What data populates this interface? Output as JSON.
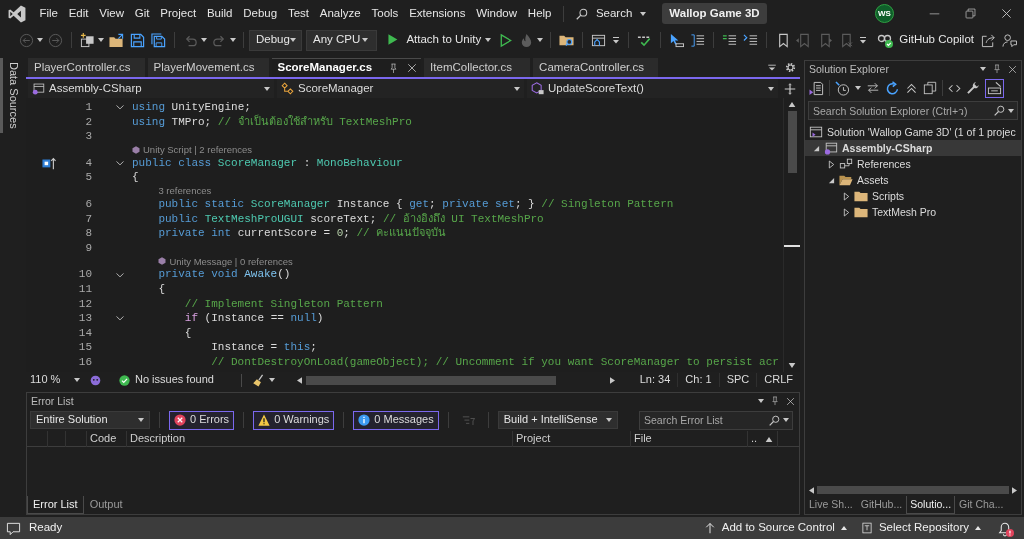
{
  "menu_bar": {
    "items": [
      "File",
      "Edit",
      "View",
      "Git",
      "Project",
      "Build",
      "Debug",
      "Test",
      "Analyze",
      "Tools",
      "Extensions",
      "Window",
      "Help"
    ],
    "search": "Search",
    "solution_name": "Wallop Game 3D",
    "user_initials": "WS"
  },
  "toolbar": {
    "back": {
      "disabled": true
    },
    "forward": {
      "disabled": true
    },
    "undo": {
      "disabled": true
    },
    "redo": {
      "disabled": true
    },
    "hot_reload": {
      "disabled": true
    },
    "previous_bookmark": {
      "disabled": true
    },
    "next_bookmark": {
      "disabled": true
    },
    "clear_bookmarks": {
      "disabled": true
    },
    "configuration": "Debug",
    "platform": "Any CPU",
    "start": "Attach to Unity",
    "copilot": "GitHub Copilot"
  },
  "side_tab": "Data Sources",
  "editor": {
    "tabs": [
      {
        "label": "PlayerController.cs",
        "selected": false
      },
      {
        "label": "PlayerMovement.cs",
        "selected": false
      },
      {
        "label": "ScoreManager.cs",
        "selected": true
      },
      {
        "label": "ItemCollector.cs",
        "selected": false
      },
      {
        "label": "CameraController.cs",
        "selected": false
      }
    ],
    "navigation_bar": [
      "Assembly-CSharp",
      "ScoreManager",
      "UpdateScoreText()"
    ],
    "lines": [
      {
        "kind": "code",
        "number": "1",
        "fold": true,
        "gutter_icon": false,
        "tokens": [
          {
            "kind": "keyword",
            "text": "using"
          },
          {
            "kind": "plain",
            "text": " UnityEngine;"
          }
        ]
      },
      {
        "kind": "code",
        "number": "2",
        "fold": false,
        "gutter_icon": false,
        "tokens": [
          {
            "kind": "keyword",
            "text": "using"
          },
          {
            "kind": "plain",
            "text": " TMPro; "
          },
          {
            "kind": "comment",
            "text": "// จำเป็นต้องใช้สำหรับ TextMeshPro"
          }
        ]
      },
      {
        "kind": "code",
        "number": "3",
        "fold": false,
        "gutter_icon": false
      },
      {
        "kind": "codelens",
        "icon": true,
        "text": "Unity Script | 2 references"
      },
      {
        "kind": "code",
        "number": "4",
        "fold": true,
        "gutter_icon": true,
        "tokens": [
          {
            "kind": "keyword",
            "text": "public class "
          },
          {
            "kind": "type",
            "text": "ScoreManager"
          },
          {
            "kind": "plain",
            "text": " : "
          },
          {
            "kind": "type",
            "text": "MonoBehaviour"
          }
        ]
      },
      {
        "kind": "code",
        "number": "5",
        "fold": false,
        "gutter_icon": false,
        "tokens": [
          {
            "kind": "plain",
            "text": "{"
          }
        ]
      },
      {
        "kind": "codelens",
        "icon": false,
        "text": "3 references"
      },
      {
        "kind": "code",
        "number": "6",
        "fold": false,
        "gutter_icon": false,
        "tokens": [
          {
            "kind": "keyword",
            "text": "    public static "
          },
          {
            "kind": "type",
            "text": "ScoreManager"
          },
          {
            "kind": "plain",
            "text": " Instance { "
          },
          {
            "kind": "keyword",
            "text": "get"
          },
          {
            "kind": "plain",
            "text": "; "
          },
          {
            "kind": "keyword",
            "text": "private set"
          },
          {
            "kind": "plain",
            "text": "; } "
          },
          {
            "kind": "comment",
            "text": "// Singleton Pattern"
          }
        ]
      },
      {
        "kind": "code",
        "number": "7",
        "fold": false,
        "gutter_icon": false,
        "tokens": [
          {
            "kind": "keyword",
            "text": "    public "
          },
          {
            "kind": "type",
            "text": "TextMeshProUGUI"
          },
          {
            "kind": "plain",
            "text": " scoreText; "
          },
          {
            "kind": "comment",
            "text": "// อ้างอิงถึง UI TextMeshPro"
          }
        ]
      },
      {
        "kind": "code",
        "number": "8",
        "fold": false,
        "gutter_icon": false,
        "tokens": [
          {
            "kind": "keyword",
            "text": "    private int"
          },
          {
            "kind": "plain",
            "text": " currentScore = "
          },
          {
            "kind": "number",
            "text": "0"
          },
          {
            "kind": "plain",
            "text": "; "
          },
          {
            "kind": "comment",
            "text": "// คะแนนปัจจุบัน"
          }
        ]
      },
      {
        "kind": "code",
        "number": "9",
        "fold": false,
        "gutter_icon": false
      },
      {
        "kind": "codelens",
        "icon": true,
        "text": "Unity Message | 0 references"
      },
      {
        "kind": "code",
        "number": "10",
        "fold": true,
        "gutter_icon": false,
        "tokens": [
          {
            "kind": "keyword",
            "text": "    private void "
          },
          {
            "kind": "method",
            "text": "Awake"
          },
          {
            "kind": "plain",
            "text": "()"
          }
        ]
      },
      {
        "kind": "code",
        "number": "11",
        "fold": false,
        "gutter_icon": false,
        "tokens": [
          {
            "kind": "plain",
            "text": "    {"
          }
        ]
      },
      {
        "kind": "code",
        "number": "12",
        "fold": false,
        "gutter_icon": false,
        "tokens": [
          {
            "kind": "comment",
            "text": "        // Implement Singleton Pattern"
          }
        ]
      },
      {
        "kind": "code",
        "number": "13",
        "fold": true,
        "gutter_icon": false,
        "tokens": [
          {
            "kind": "control",
            "text": "        if"
          },
          {
            "kind": "plain",
            "text": " (Instance == "
          },
          {
            "kind": "keyword",
            "text": "null"
          },
          {
            "kind": "plain",
            "text": ")"
          }
        ]
      },
      {
        "kind": "code",
        "number": "14",
        "fold": false,
        "gutter_icon": false,
        "tokens": [
          {
            "kind": "plain",
            "text": "        {"
          }
        ]
      },
      {
        "kind": "code",
        "number": "15",
        "fold": false,
        "gutter_icon": false,
        "tokens": [
          {
            "kind": "plain",
            "text": "            Instance = "
          },
          {
            "kind": "keyword",
            "text": "this"
          },
          {
            "kind": "plain",
            "text": ";"
          }
        ]
      },
      {
        "kind": "code",
        "number": "16",
        "fold": false,
        "gutter_icon": false,
        "tokens": [
          {
            "kind": "comment",
            "text": "            // DontDestroyOnLoad(gameObject); // Uncomment if you want ScoreManager to persist acr"
          }
        ]
      }
    ],
    "status": {
      "zoom": "110 %",
      "issues": "No issues found",
      "line": "Ln: 34",
      "column": "Ch: 1",
      "indentation": "SPC",
      "line_ending": "CRLF"
    }
  },
  "error_list": {
    "title": "Error List",
    "scope": "Entire Solution",
    "filters": [
      {
        "kind": "error",
        "label": "0 Errors",
        "on": true
      },
      {
        "kind": "warning",
        "label": "0 Warnings",
        "on": true
      },
      {
        "kind": "message",
        "label": "0 Messages",
        "on": true
      }
    ],
    "source": "Build + IntelliSense",
    "search": {
      "placeholder": "Search Error List"
    },
    "columns": [
      "Code",
      "Description",
      "Project",
      "File",
      ".."
    ],
    "tabs": [
      {
        "label": "Error List",
        "selected": true
      },
      {
        "label": "Output",
        "selected": false
      }
    ]
  },
  "solution_explorer": {
    "title": "Solution Explorer",
    "preview_toggle": {
      "on": true
    },
    "search": {
      "placeholder": "Search Solution Explorer (Ctrl+ว)"
    },
    "tree": {
      "label": "Solution 'Wallop Game 3D' (1 of 1 projec",
      "kind": "solution",
      "selected": false,
      "children": [
        {
          "label": "Assembly-CSharp",
          "kind": "project",
          "expanded": true,
          "selected": true,
          "children": [
            {
              "label": "References",
              "kind": "references",
              "expanded": false,
              "selected": false
            },
            {
              "label": "Assets",
              "kind": "folder",
              "expanded": true,
              "selected": false,
              "children": [
                {
                  "label": "Scripts",
                  "kind": "folder",
                  "expanded": false,
                  "selected": false
                },
                {
                  "label": "TextMesh Pro",
                  "kind": "folder",
                  "expanded": false,
                  "selected": false
                }
              ]
            }
          ]
        }
      ]
    },
    "tabs": [
      {
        "label": "Live Sh...",
        "selected": false
      },
      {
        "label": "GitHub...",
        "selected": false
      },
      {
        "label": "Solutio...",
        "selected": true
      },
      {
        "label": "Git Cha...",
        "selected": false
      }
    ]
  },
  "status_bar": {
    "message": "Ready",
    "source_control": "Add to Source Control",
    "repository": "Select Repository",
    "notification_alert": true
  }
}
